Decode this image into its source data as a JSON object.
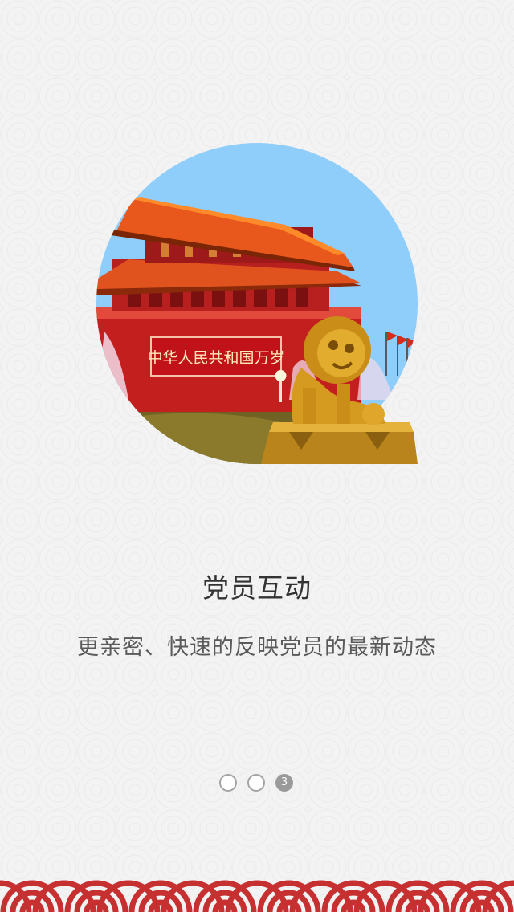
{
  "slide": {
    "title": "党员互动",
    "subtitle": "更亲密、快速的反映党员的最新动态"
  },
  "pager": {
    "active_label": "3"
  },
  "illustration": {
    "banner_text": "中华人民共和国万岁"
  },
  "colors": {
    "sky": "#8fcdfb",
    "roof": "#e84d1c",
    "red": "#d42b1d",
    "gold": "#d69c1f",
    "wave": "#c63030"
  }
}
